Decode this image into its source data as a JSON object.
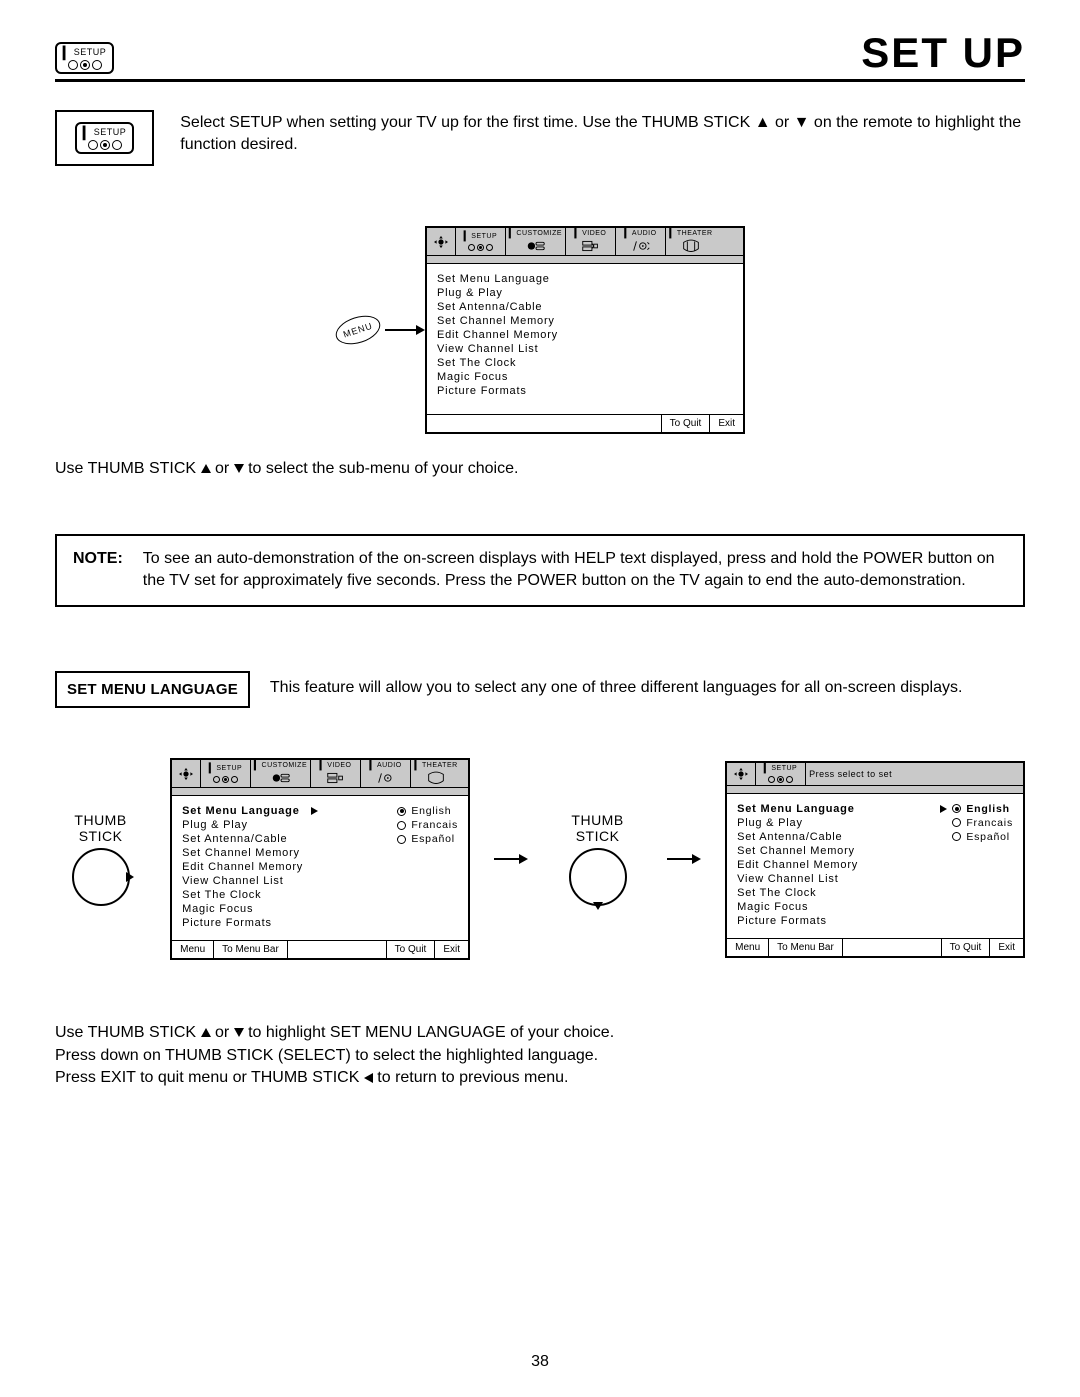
{
  "header": {
    "icon_label": "SETUP",
    "title": "SET UP",
    "intro": "Select SETUP when setting your TV up for the first time.  Use the THUMB STICK ▲ or ▼ on the remote to highlight the function desired."
  },
  "osd_tabs": {
    "setup": "SETUP",
    "customize": "CUSTOMIZE",
    "video": "VIDEO",
    "audio": "AUDIO",
    "theater": "THEATER"
  },
  "osd_menu": {
    "items": [
      "Set Menu Language",
      "Plug & Play",
      "Set Antenna/Cable",
      "Set Channel Memory",
      "Edit Channel Memory",
      "View Channel List",
      "Set The Clock",
      "Magic Focus",
      "Picture Formats"
    ],
    "footer_menu": "Menu",
    "footer_bar": "To Menu Bar",
    "footer_quit": "To Quit",
    "footer_exit": "Exit",
    "hint": "Press select to set"
  },
  "menu_button_label": "MENU",
  "submenu_note": "Use THUMB STICK ▲ or ▼ to select the sub-menu of your choice.",
  "note": {
    "label": "NOTE:",
    "text": "To see an auto-demonstration of the on-screen displays with HELP text displayed, press and hold the POWER button on the TV set for approximately five seconds. Press the POWER button on the TV again to end the auto-demonstration."
  },
  "language": {
    "box_label": "SET MENU LANGUAGE",
    "desc": "This feature will allow you to select any one of three different languages for all on-screen displays.",
    "options": {
      "english": "English",
      "francais": "Francais",
      "espanol": "Español"
    }
  },
  "thumb_label": "THUMB STICK",
  "bottom_instructions": {
    "l1": "Use THUMB STICK ▲ or ▼ to highlight SET MENU LANGUAGE of your choice.",
    "l2": "Press down on THUMB STICK (SELECT) to select the highlighted language.",
    "l3": "Press EXIT to quit menu or THUMB STICK ◀ to return to previous menu."
  },
  "page_number": "38"
}
